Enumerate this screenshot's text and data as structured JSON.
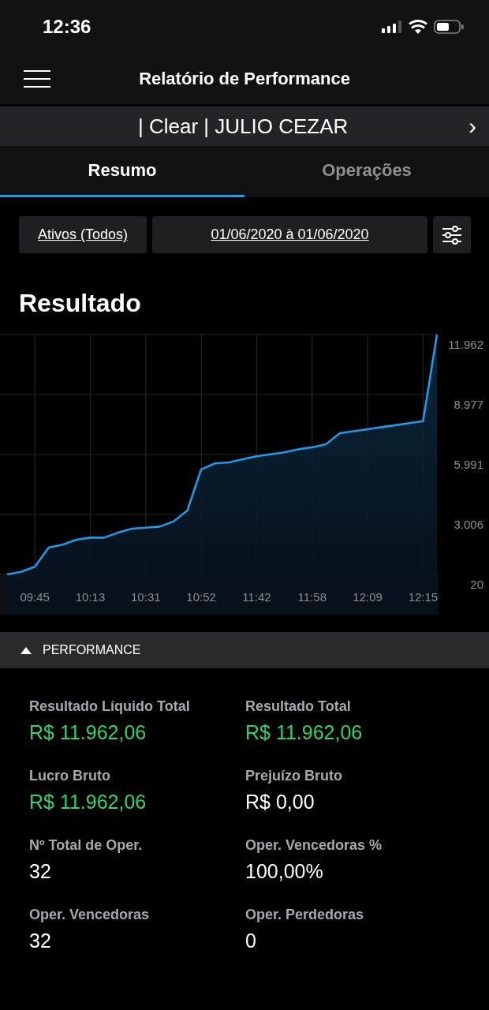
{
  "status_bar": {
    "time": "12:36"
  },
  "header": {
    "title": "Relatório de Performance"
  },
  "account_bar": {
    "text": "| Clear | JULIO CEZAR",
    "chevron": "›"
  },
  "tabs": [
    {
      "label": "Resumo",
      "selected": true
    },
    {
      "label": "Operações",
      "selected": false
    }
  ],
  "filters": {
    "assets": "Ativos (Todos)",
    "date_range": "01/06/2020 à 01/06/2020"
  },
  "result": {
    "title": "Resultado",
    "chart_data": {
      "type": "area",
      "categories": [
        null,
        null,
        "09:45",
        null,
        null,
        null,
        "10:13",
        null,
        null,
        null,
        "10:31",
        null,
        null,
        null,
        "10:52",
        null,
        null,
        null,
        "11:42",
        null,
        null,
        null,
        "11:58",
        null,
        null,
        null,
        "12:09",
        null,
        null,
        null,
        "12:15",
        null
      ],
      "series": [
        {
          "color": "#1e9be8",
          "values": [
            20,
            150,
            400,
            1350,
            1500,
            1750,
            1850,
            1850,
            2100,
            2300,
            2350,
            2400,
            2650,
            3200,
            5250,
            5550,
            5600,
            5750,
            5900,
            6000,
            6100,
            6250,
            6350,
            6500,
            7050,
            7150,
            7250,
            7350,
            7450,
            7550,
            7650,
            11962
          ]
        }
      ],
      "ylim": [
        20,
        11962
      ],
      "grid": true,
      "yticks": [
        {
          "value": 20,
          "label": "20"
        },
        {
          "value": 3006,
          "label": "3.006"
        },
        {
          "value": 5991,
          "label": "5.991"
        },
        {
          "value": 8977,
          "label": "8.977"
        },
        {
          "value": 11962,
          "label": "11.962"
        }
      ]
    }
  },
  "performance": {
    "title": "PERFORMANCE",
    "expanded": true,
    "stats": [
      {
        "label": "Resultado Líquido Total",
        "value": "R$ 11.962,06",
        "color": "#30d46a"
      },
      {
        "label": "Resultado Total",
        "value": "R$ 11.962,06",
        "color": "#30d46a"
      },
      {
        "label": "Lucro Bruto",
        "value": "R$ 11.962,06",
        "color": "#30d46a"
      },
      {
        "label": "Prejuízo Bruto",
        "value": "R$ 0,00",
        "color": "#ffffff"
      },
      {
        "label": "Nº Total de Oper.",
        "value": "32",
        "color": "#ffffff"
      },
      {
        "label": "Oper. Vencedoras %",
        "value": "100,00%",
        "color": "#ffffff"
      },
      {
        "label": "Oper. Vencedoras",
        "value": "32",
        "color": "#ffffff"
      },
      {
        "label": "Oper. Perdedoras",
        "value": "0",
        "color": "#ffffff"
      }
    ]
  }
}
